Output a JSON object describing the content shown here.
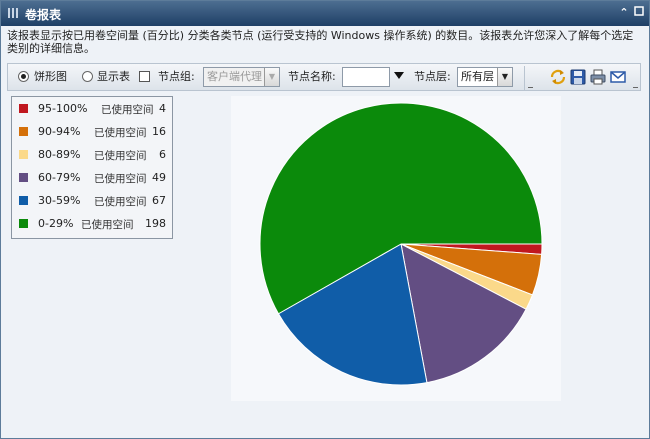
{
  "window": {
    "title": "卷报表"
  },
  "description": [
    "该报表显示按已用卷空间量 (百分比) 分类各类节点 (运行受支持的 Windows 操作系统) 的数目。该报表允许您深入了解每个选定",
    "类别的详细信息。"
  ],
  "toolbar": {
    "pie_label": "饼形图",
    "table_label": "显示表",
    "node_group_label": "节点组:",
    "node_group_value": "客户端代理",
    "node_name_label": "节点名称:",
    "node_name_value": "",
    "node_layer_label": "节点层:",
    "node_layer_value": "所有层"
  },
  "legend": {
    "used_text": "已使用空间",
    "items": [
      {
        "range": "95-100%",
        "count": "4",
        "color": "#c0171f"
      },
      {
        "range": "90-94%",
        "count": "16",
        "color": "#d4700a"
      },
      {
        "range": "80-89%",
        "count": "6",
        "color": "#fbd98a"
      },
      {
        "range": "60-79%",
        "count": "49",
        "color": "#634e83"
      },
      {
        "range": "30-59%",
        "count": "67",
        "color": "#105da8"
      },
      {
        "range": "0-29%",
        "count": "198",
        "color": "#0b8a0b"
      }
    ]
  },
  "chart_data": {
    "type": "pie",
    "categories": [
      "95-100% 已使用空间",
      "90-94% 已使用空间",
      "80-89% 已使用空间",
      "60-79% 已使用空间",
      "30-59% 已使用空间",
      "0-29% 已使用空间"
    ],
    "values": [
      4,
      16,
      6,
      49,
      67,
      198
    ],
    "colors": [
      "#c0171f",
      "#d4700a",
      "#fbd98a",
      "#634e83",
      "#105da8",
      "#0b8a0b"
    ]
  }
}
